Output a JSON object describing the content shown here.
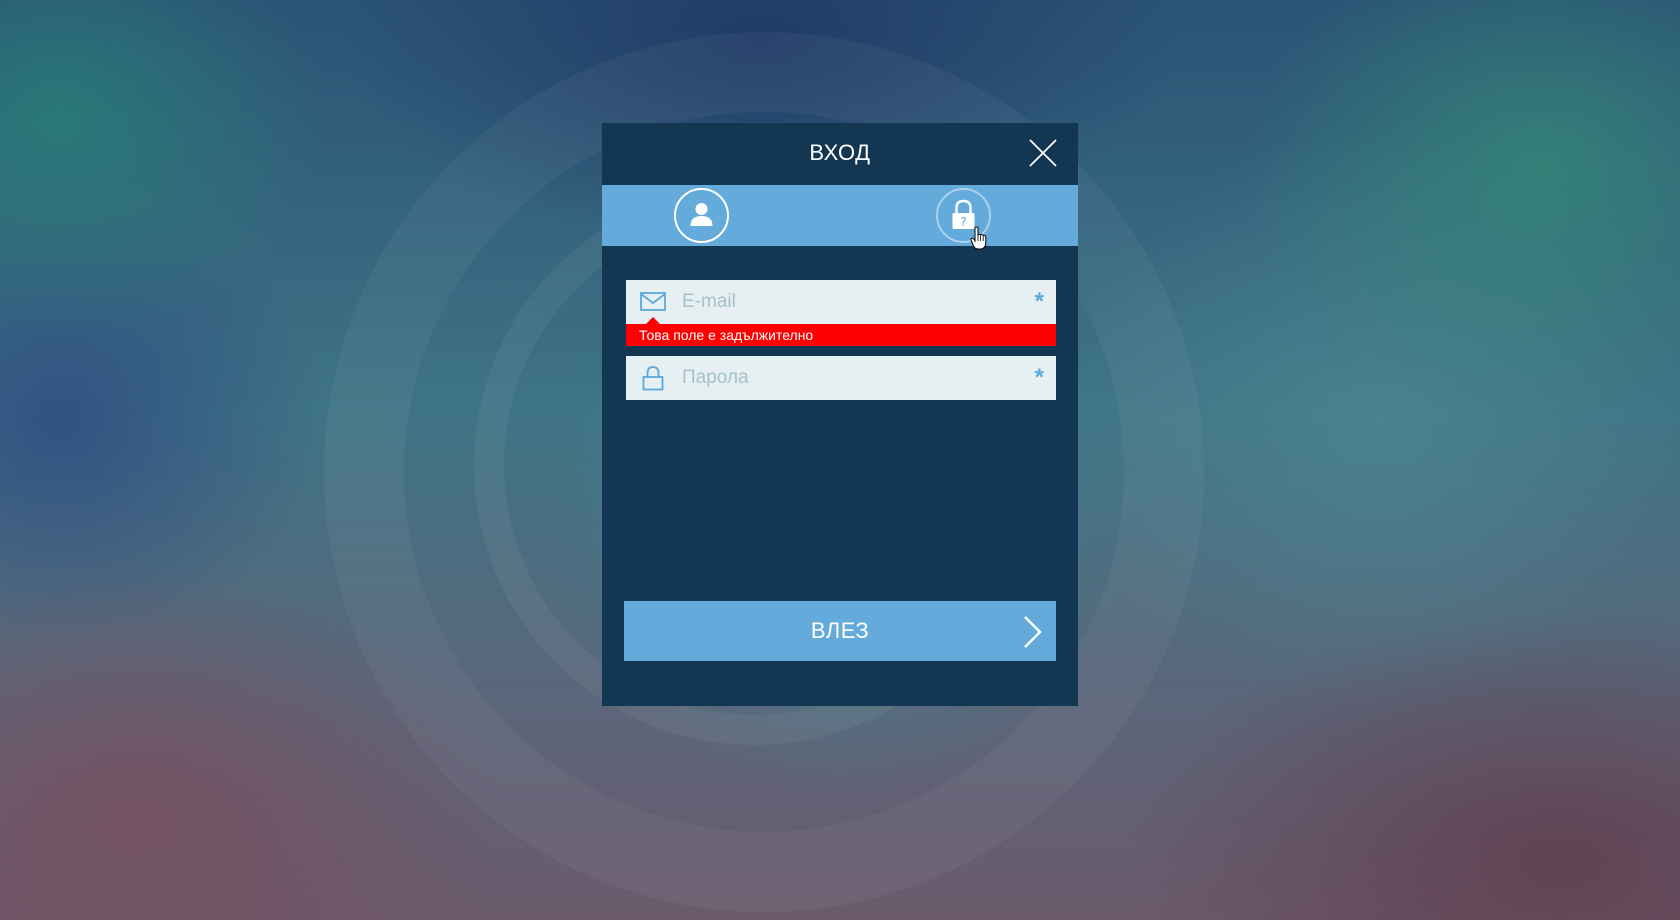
{
  "modal": {
    "title": "ВХОД",
    "close_icon": "close-icon"
  },
  "tabs": [
    {
      "name": "login",
      "icon": "user-icon",
      "active": true
    },
    {
      "name": "forgot-password",
      "icon": "lock-question-icon",
      "active": false
    }
  ],
  "form": {
    "email": {
      "value": "",
      "placeholder": "E-mail",
      "icon": "envelope-icon",
      "required_mark": "*",
      "error": "Това поле е задължително"
    },
    "password": {
      "value": "",
      "placeholder": "Парола",
      "icon": "lock-icon",
      "required_mark": "*"
    },
    "submit": {
      "label": "ВЛЕЗ",
      "icon": "chevron-right-icon"
    }
  },
  "colors": {
    "panel": "#133652",
    "accent": "#64abdc",
    "field_bg": "#e6f0f2",
    "error": "#ff0000"
  }
}
